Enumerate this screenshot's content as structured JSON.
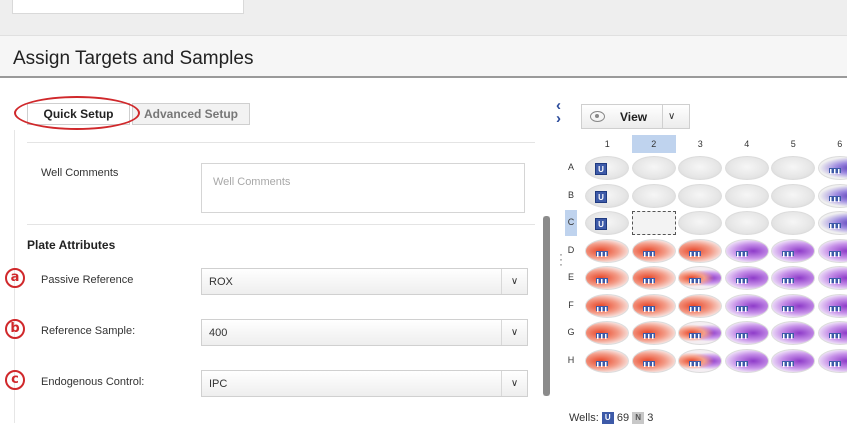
{
  "page": {
    "title": "Assign Targets and Samples"
  },
  "tabs": {
    "quick_setup": "Quick Setup",
    "advanced_setup": "Advanced Setup"
  },
  "form": {
    "well_comments_label": "Well Comments",
    "well_comments_placeholder": "Well Comments",
    "plate_attributes_title": "Plate Attributes",
    "passive_reference": {
      "marker": "a",
      "label": "Passive Reference",
      "value": "ROX"
    },
    "reference_sample": {
      "marker": "b",
      "label": "Reference Sample:",
      "value": "400"
    },
    "endogenous_control": {
      "marker": "c",
      "label": "Endogenous Control:",
      "value": "IPC"
    }
  },
  "plate": {
    "view_label": "View",
    "columns": [
      "1",
      "2",
      "3",
      "4",
      "5",
      "6"
    ],
    "rows": [
      "A",
      "B",
      "C",
      "D",
      "E",
      "F",
      "G",
      "H"
    ],
    "selected_column": "2",
    "selected_row": "C",
    "selected_well": "C2",
    "wells": {
      "A": [
        "U",
        "empty",
        "empty",
        "empty",
        "empty",
        "purple-tube"
      ],
      "B": [
        "U",
        "empty",
        "empty",
        "empty",
        "empty",
        "purple-tube"
      ],
      "C": [
        "U",
        "selected",
        "empty",
        "empty",
        "empty",
        "purple-tube"
      ],
      "D": [
        "red",
        "red",
        "red",
        "purple",
        "purple",
        "purple"
      ],
      "E": [
        "red",
        "red",
        "mixed",
        "purple",
        "purple",
        "purple"
      ],
      "F": [
        "red",
        "red",
        "red",
        "purple",
        "purple",
        "purple"
      ],
      "G": [
        "red",
        "red",
        "mixed",
        "purple",
        "purple",
        "purple"
      ],
      "H": [
        "red",
        "red",
        "mixed",
        "purple",
        "purple",
        "purple"
      ]
    },
    "footer": {
      "prefix": "Wells:",
      "unknown_badge": "U",
      "unknown_count": "69",
      "ntc_badge": "N",
      "ntc_count": "3"
    }
  },
  "colors": {
    "accent_blue": "#3d5aa8",
    "highlight_red": "#d0282b",
    "well_red": "#e84628",
    "well_purple": "#8e3bc9"
  }
}
